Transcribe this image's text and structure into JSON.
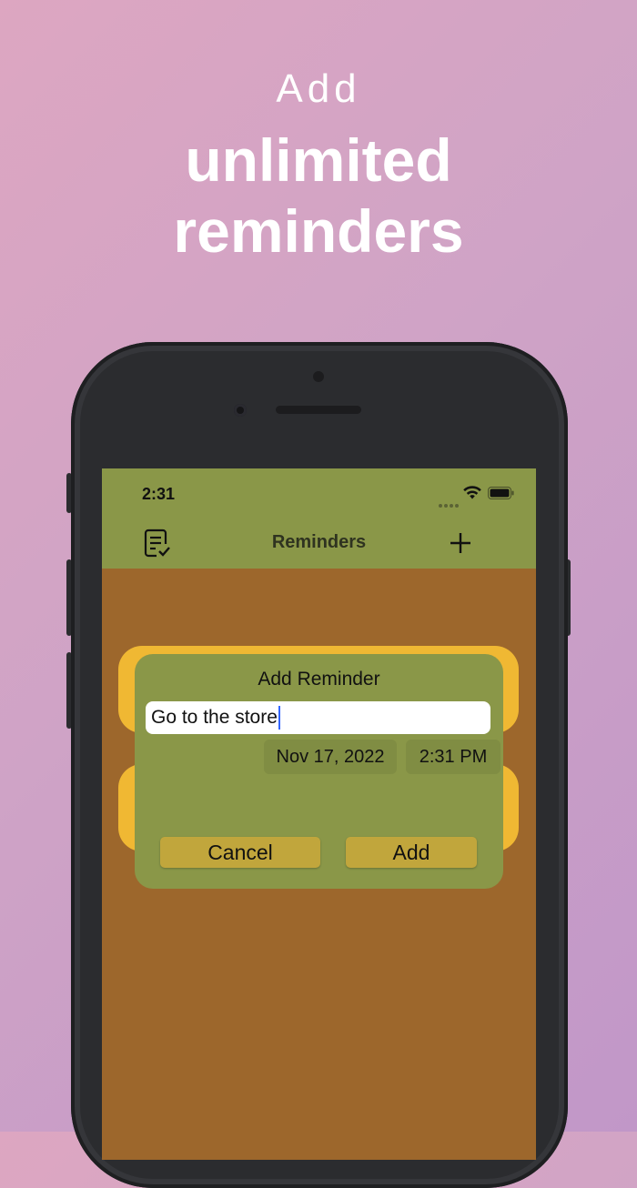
{
  "headline": {
    "line1": "Add",
    "line2": "unlimited",
    "line3": "reminders"
  },
  "status_bar": {
    "time": "2:31",
    "icons": [
      "signal-dots-icon",
      "wifi-icon",
      "battery-icon"
    ]
  },
  "nav": {
    "title": "Reminders",
    "left_icon": "checklist-icon",
    "right_icon": "plus-icon"
  },
  "dialog": {
    "title": "Add Reminder",
    "text_value": "Go to the store",
    "date": "Nov 17, 2022",
    "time": "2:31 PM",
    "cancel_label": "Cancel",
    "add_label": "Add"
  },
  "colors": {
    "background_gradient": [
      "#dda6c1",
      "#c197c8"
    ],
    "nav_bar": "#8a9748",
    "screen_bg": "#9d672c",
    "card": "#f0b833",
    "button": "#c1a63c"
  }
}
